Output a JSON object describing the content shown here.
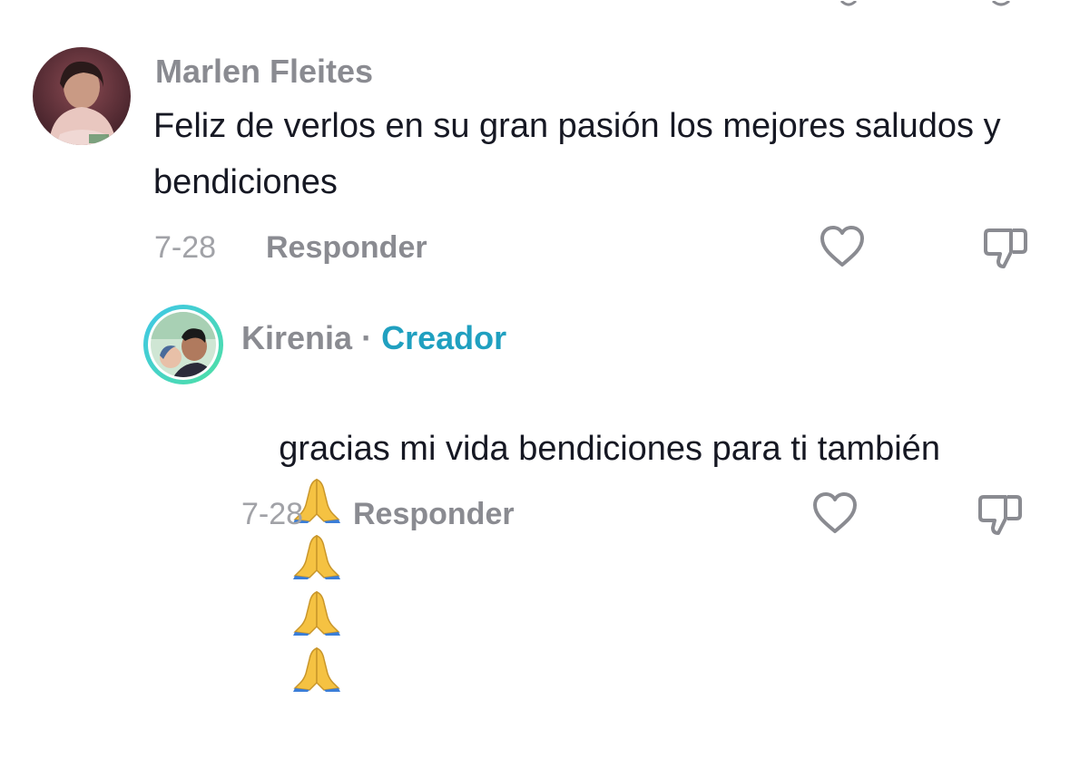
{
  "comments": [
    {
      "author": "Marlen Fleites",
      "text": "Feliz de verlos en su gran pasión los mejores saludos y bendiciones",
      "date": "7-28",
      "reply_label": "Responder",
      "avatar_icon": "user-photo"
    }
  ],
  "reply": {
    "author": "Kirenia",
    "separator": "·",
    "badge": "Creador",
    "text": "gracias mi vida bendiciones para ti también",
    "emoji_icon": "folded-hands",
    "date": "7-28",
    "reply_label": "Responder",
    "avatar_icon": "user-photo",
    "ring_colors": [
      "#3ec6e8",
      "#4fe0a4"
    ]
  },
  "icons": {
    "like": "heart-outline-icon",
    "dislike": "thumbs-down-outline-icon"
  },
  "colors": {
    "name_gray": "#8a8b91",
    "creator_blue": "#20a0c0",
    "text_dark": "#161823"
  }
}
